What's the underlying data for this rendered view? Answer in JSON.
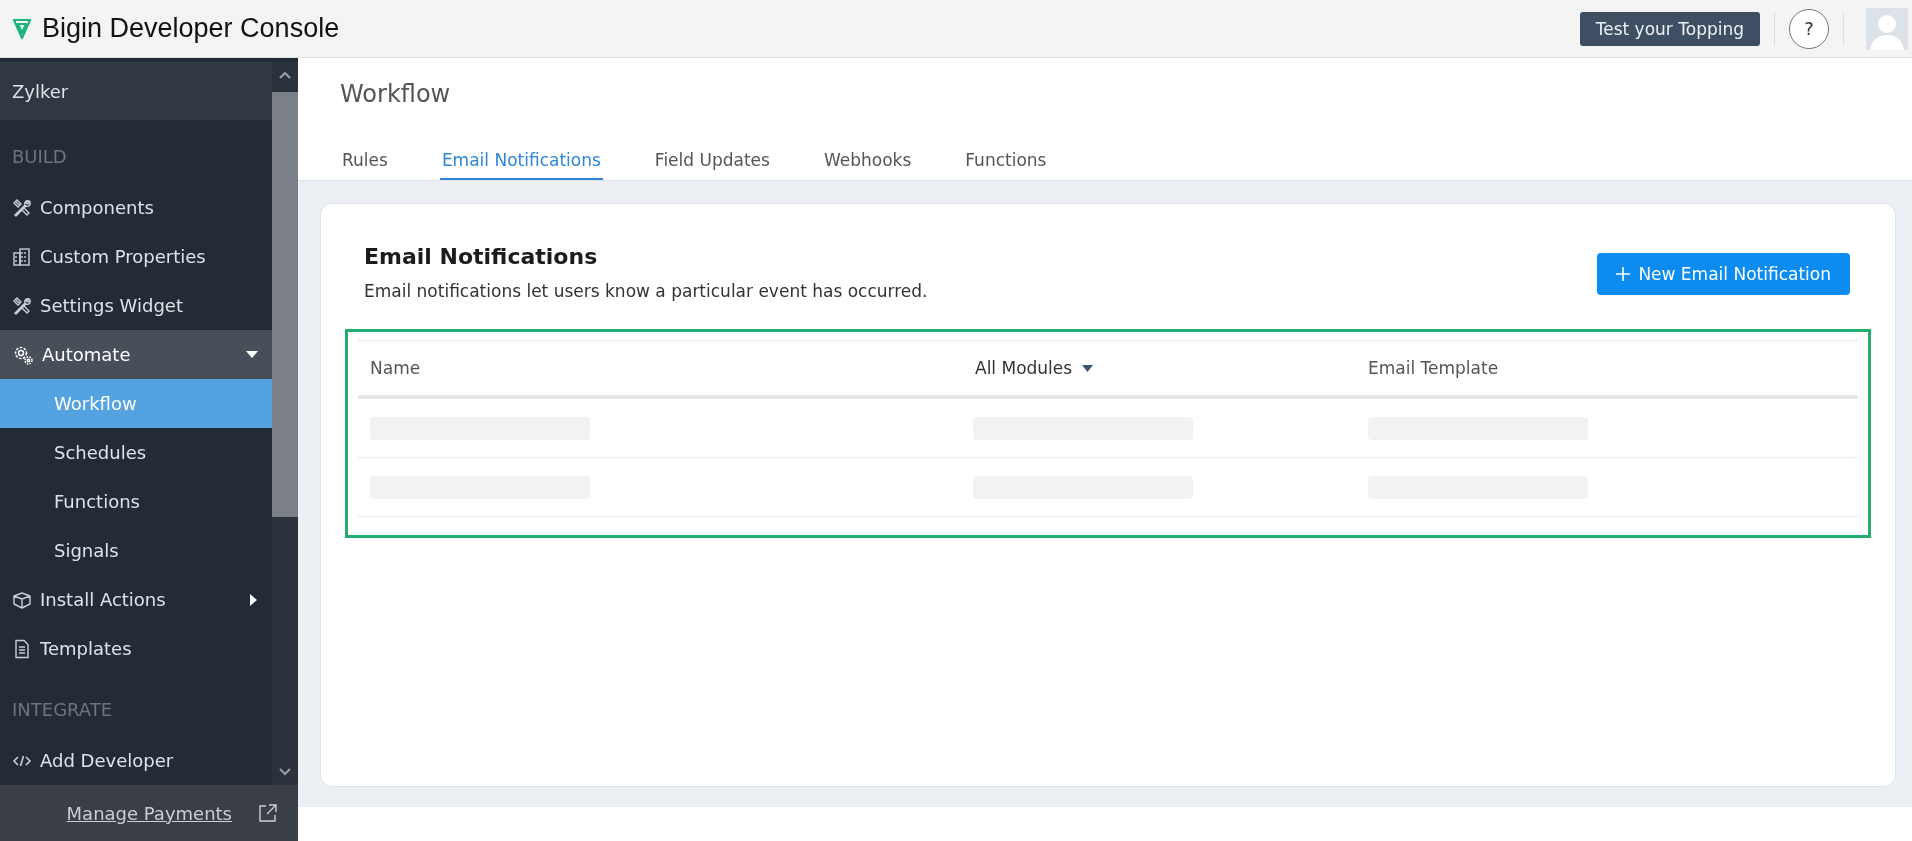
{
  "header": {
    "title": "Bigin Developer Console",
    "test_button": "Test your Topping",
    "help": "?"
  },
  "sidebar": {
    "workspace": "Zylker",
    "sections": [
      {
        "label": "BUILD",
        "items": [
          {
            "label": "Components",
            "selected": false
          },
          {
            "label": "Custom Properties",
            "selected": false
          },
          {
            "label": "Settings Widget",
            "selected": false
          },
          {
            "label": "Automate",
            "selected": false,
            "expanded": true,
            "children": [
              {
                "label": "Workflow",
                "selected": true
              },
              {
                "label": "Schedules",
                "selected": false
              },
              {
                "label": "Functions",
                "selected": false
              },
              {
                "label": "Signals",
                "selected": false
              }
            ]
          },
          {
            "label": "Install Actions",
            "selected": false,
            "expanded": false
          },
          {
            "label": "Templates",
            "selected": false
          }
        ]
      },
      {
        "label": "INTEGRATE",
        "items": [
          {
            "label": "Add Developer",
            "selected": false
          }
        ]
      }
    ],
    "footer_link": "Manage Payments"
  },
  "page": {
    "title": "Workflow",
    "tabs": [
      {
        "label": "Rules",
        "selected": false
      },
      {
        "label": "Email Notifications",
        "selected": true
      },
      {
        "label": "Field Updates",
        "selected": false
      },
      {
        "label": "Webhooks",
        "selected": false
      },
      {
        "label": "Functions",
        "selected": false
      }
    ]
  },
  "card": {
    "heading": "Email Notifications",
    "description": "Email notifications let users know a particular event has occurred.",
    "new_button": "New Email Notification",
    "table": {
      "columns": [
        {
          "label": "Name",
          "kind": "plain"
        },
        {
          "label": "All Modules",
          "kind": "filter"
        },
        {
          "label": "Email Template",
          "kind": "plain"
        }
      ]
    }
  }
}
